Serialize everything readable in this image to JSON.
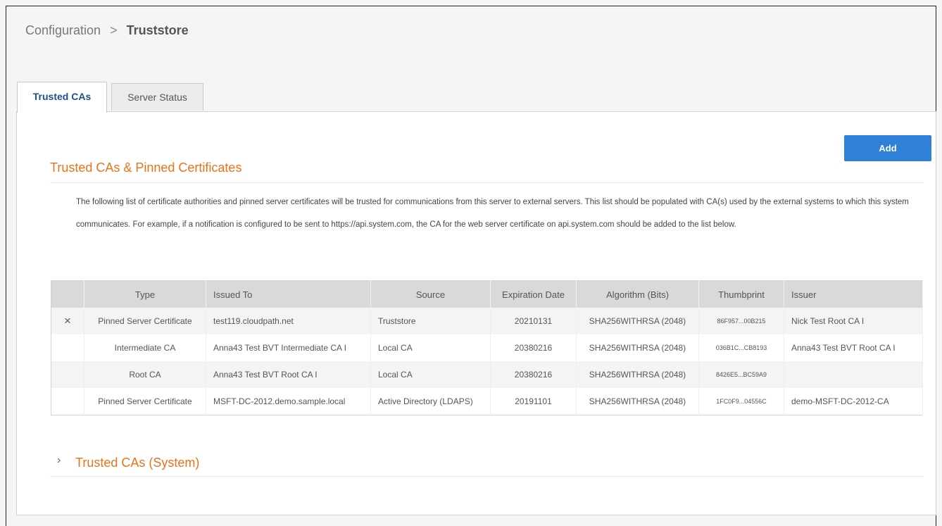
{
  "breadcrumb": {
    "parent": "Configuration",
    "separator": ">",
    "current": "Truststore"
  },
  "tabs": [
    {
      "label": "Trusted CAs",
      "active": true
    },
    {
      "label": "Server Status",
      "active": false
    }
  ],
  "section": {
    "title": "Trusted CAs & Pinned Certificates",
    "add_label": "Add",
    "description": "The following list of certificate authorities and pinned server certificates will be trusted for communications from this server to external servers. This list should be populated with CA(s) used by the external systems to which this system communicates. For example, if a notification is configured to be sent to https://api.system.com, the CA for the web server certificate on api.system.com should be added to the list below."
  },
  "table": {
    "headers": [
      "",
      "Type",
      "Issued To",
      "Source",
      "Expiration Date",
      "Algorithm (Bits)",
      "Thumbprint",
      "Issuer"
    ],
    "rows": [
      {
        "action": "×",
        "type": "Pinned Server Certificate",
        "issued_to": "test119.cloudpath.net",
        "source": "Truststore",
        "expiration": "20210131",
        "algorithm": "SHA256WITHRSA (2048)",
        "thumbprint": "86F957...00B215",
        "issuer": "Nick Test Root CA I"
      },
      {
        "action": "",
        "type": "Intermediate CA",
        "issued_to": "Anna43 Test BVT Intermediate CA I",
        "source": "Local CA",
        "expiration": "20380216",
        "algorithm": "SHA256WITHRSA (2048)",
        "thumbprint": "036B1C...CB8193",
        "issuer": "Anna43 Test BVT Root CA I"
      },
      {
        "action": "",
        "type": "Root CA",
        "issued_to": "Anna43 Test BVT Root CA I",
        "source": "Local CA",
        "expiration": "20380216",
        "algorithm": "SHA256WITHRSA (2048)",
        "thumbprint": "8426E5...BC59A9",
        "issuer": ""
      },
      {
        "action": "",
        "type": "Pinned Server Certificate",
        "issued_to": "MSFT-DC-2012.demo.sample.local",
        "source": "Active Directory (LDAPS)",
        "expiration": "20191101",
        "algorithm": "SHA256WITHRSA (2048)",
        "thumbprint": "1FC0F9...04556C",
        "issuer": "demo-MSFT-DC-2012-CA"
      }
    ]
  },
  "system_section": {
    "chevron": "›",
    "title": "Trusted CAs (System)"
  },
  "colors": {
    "accent_orange": "#e8731a",
    "button_blue": "#2f80d8",
    "tab_active_text": "#1f4e8c",
    "delete_red": "#c0392b"
  }
}
